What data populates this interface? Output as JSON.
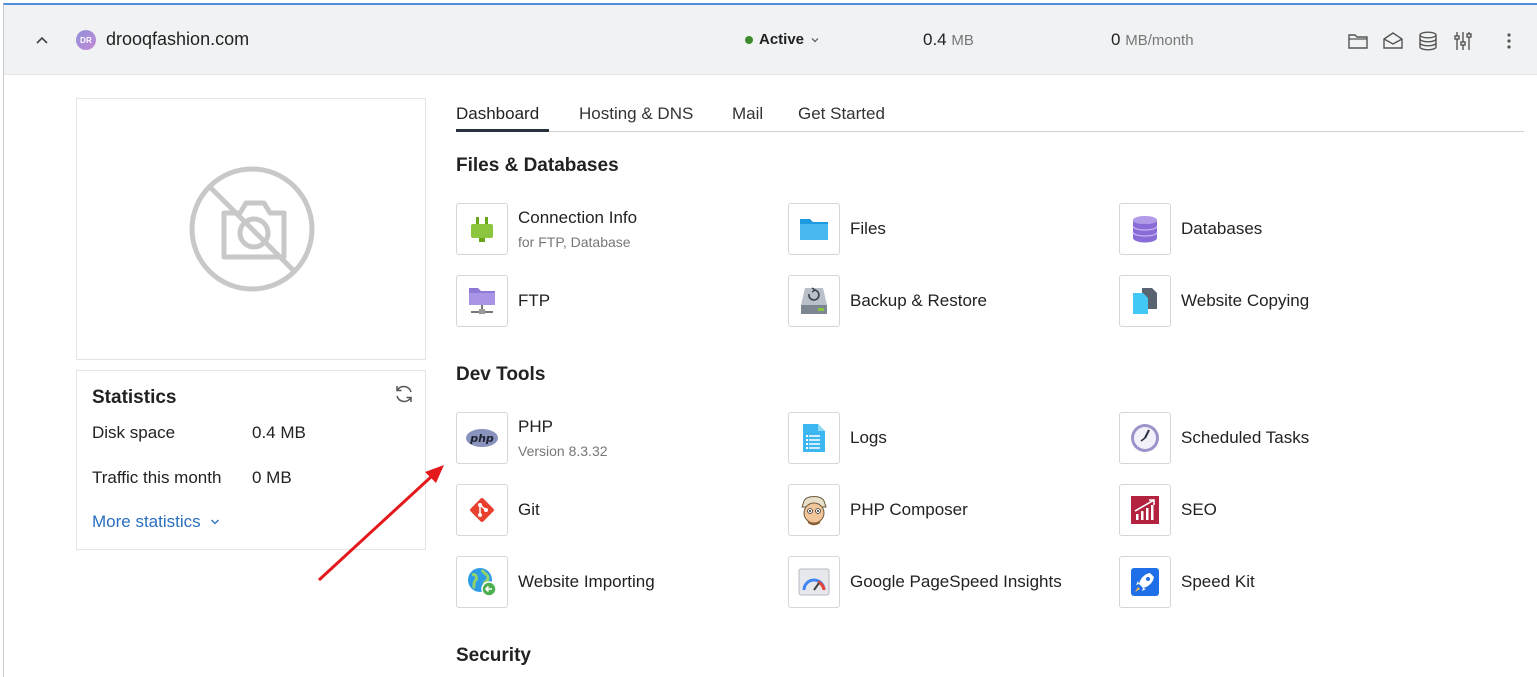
{
  "header": {
    "avatar_initials": "DR",
    "domain": "drooqfashion.com",
    "status": "Active",
    "disk_value": "0.4",
    "disk_unit": "MB",
    "traffic_value": "0",
    "traffic_unit": "MB/month",
    "icons": [
      "folder-icon",
      "mail-icon",
      "database-icon",
      "settings-sliders-icon",
      "more-vertical-icon"
    ]
  },
  "statistics": {
    "title": "Statistics",
    "disk_label": "Disk space",
    "disk_value": "0.4 MB",
    "traffic_label": "Traffic this month",
    "traffic_value": "0 MB",
    "more_label": "More statistics"
  },
  "tabs": [
    {
      "label": "Dashboard",
      "active": true
    },
    {
      "label": "Hosting & DNS",
      "active": false
    },
    {
      "label": "Mail",
      "active": false
    },
    {
      "label": "Get Started",
      "active": false
    }
  ],
  "sections": {
    "files": {
      "title": "Files & Databases",
      "items": [
        {
          "name": "Connection Info",
          "sub": "for FTP, Database",
          "icon": "plug-icon"
        },
        {
          "name": "Files",
          "icon": "folder-icon"
        },
        {
          "name": "Databases",
          "icon": "database-icon"
        },
        {
          "name": "FTP",
          "icon": "ftp-folder-icon"
        },
        {
          "name": "Backup & Restore",
          "icon": "backup-drive-icon"
        },
        {
          "name": "Website Copying",
          "icon": "copy-files-icon"
        }
      ]
    },
    "dev": {
      "title": "Dev Tools",
      "items": [
        {
          "name": "PHP",
          "sub": "Version 8.3.32",
          "icon": "php-icon"
        },
        {
          "name": "Logs",
          "icon": "log-document-icon"
        },
        {
          "name": "Scheduled Tasks",
          "icon": "clock-icon"
        },
        {
          "name": "Git",
          "icon": "git-icon"
        },
        {
          "name": "PHP Composer",
          "icon": "composer-icon"
        },
        {
          "name": "SEO",
          "icon": "seo-chart-icon"
        },
        {
          "name": "Website Importing",
          "icon": "globe-import-icon"
        },
        {
          "name": "Google PageSpeed Insights",
          "icon": "speed-gauge-icon"
        },
        {
          "name": "Speed Kit",
          "icon": "rocket-icon"
        }
      ]
    },
    "security": {
      "title": "Security"
    }
  },
  "colors": {
    "accent": "#2a6fc1",
    "status_active": "#3d8b2d",
    "annotation_arrow": "#e3191c"
  }
}
